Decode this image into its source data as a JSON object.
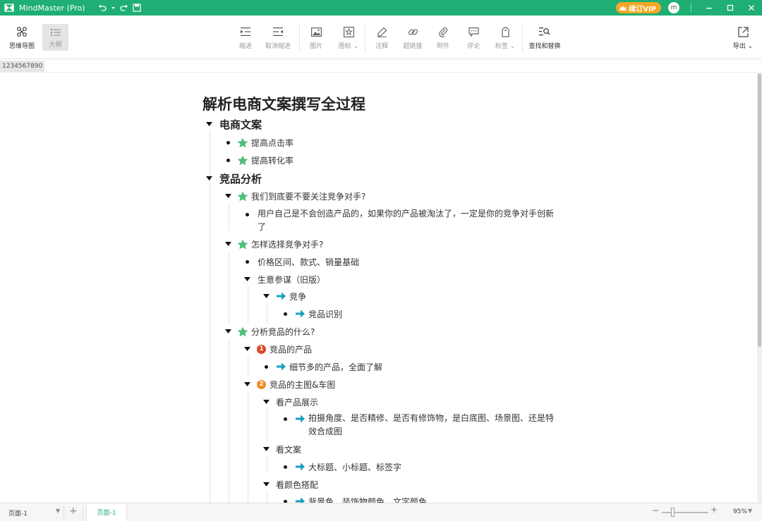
{
  "app": {
    "title": "MindMaster (Pro)",
    "vip_label": "续订VIP",
    "user_initial": "m",
    "accent": "#1fae73"
  },
  "toolbar": {
    "mindmap": "思维导图",
    "outline": "大纲",
    "indent": "缩进",
    "outdent": "取消缩进",
    "image": "图片",
    "icon": "图标",
    "icon_caret": "⌄",
    "note": "注释",
    "hyperlink": "超链接",
    "attachment": "附件",
    "comment": "评论",
    "tag": "标签",
    "tag_caret": "⌄",
    "find_replace": "查找和替换",
    "export": "导出",
    "export_caret": "⌄"
  },
  "tab_label": "1234567890",
  "outline": {
    "title": "解析电商文案撰写全过程",
    "items": [
      {
        "text": "电商文案"
      },
      {
        "text": "提高点击率"
      },
      {
        "text": "提高转化率"
      },
      {
        "text": "竞品分析"
      },
      {
        "text": "我们到底要不要关注竞争对手?"
      },
      {
        "text": "用户自己是不会创造产品的，如果你的产品被淘汰了，一定是你的竞争对手创新了"
      },
      {
        "text": "怎样选择竞争对手?"
      },
      {
        "text": "价格区间、款式、销量基础"
      },
      {
        "text": "生意参谋（旧版）"
      },
      {
        "text": "竞争"
      },
      {
        "text": "竞品识别"
      },
      {
        "text": "分析竞品的什么?"
      },
      {
        "text": "竞品的产品",
        "number": "1"
      },
      {
        "text": "细节多的产品，全面了解"
      },
      {
        "text": "竞品的主图&车图",
        "number": "2"
      },
      {
        "text": "看产品展示"
      },
      {
        "text": "拍摄角度、是否精修、是否有修饰物，是白底图、场景图、还是特效合成图"
      },
      {
        "text": "看文案"
      },
      {
        "text": "大标题、小标题、标签字"
      },
      {
        "text": "看颜色搭配"
      },
      {
        "text": "背景色、装饰物颜色、文字颜色"
      }
    ],
    "colors": {
      "star": "#4fbf7a",
      "arrow": "#1a9fc0",
      "num1": "#d9472b",
      "num2": "#f08a24"
    }
  },
  "status": {
    "page_select": "页面-1",
    "page_tab": "页面-1",
    "zoom": "95%",
    "add": "+",
    "minus": "−",
    "plus": "+"
  }
}
